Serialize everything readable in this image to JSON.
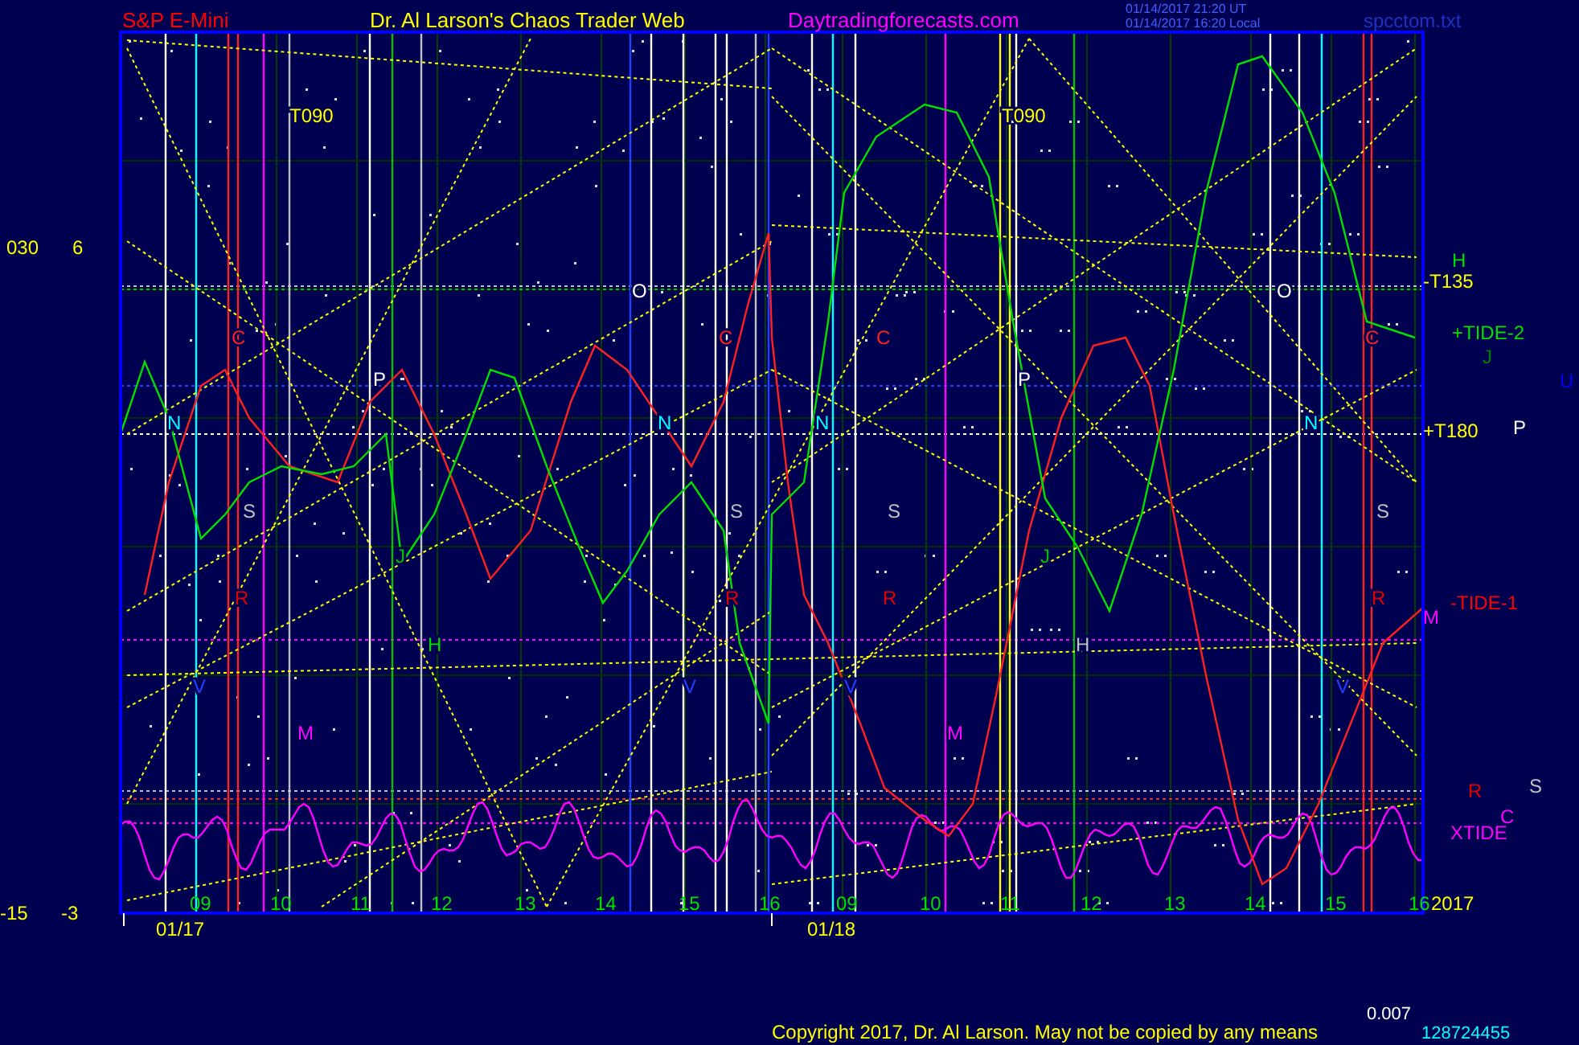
{
  "header": {
    "symbol": "S&P E-Mini",
    "title": "Dr. Al Larson's Chaos Trader Web",
    "site": "Daytradingforecasts.com",
    "time_ut": "01/14/2017 21:20 UT",
    "time_local": "01/14/2017 16:20 Local",
    "file": "spcctom.txt"
  },
  "left_labels": [
    "030",
    "6",
    "-15",
    "-3"
  ],
  "markers": [
    {
      "text": "T090",
      "color": "#ffff00"
    },
    {
      "text": "T090",
      "color": "#ffff00"
    },
    {
      "text": "O",
      "color": "#ffffff"
    },
    {
      "text": "O",
      "color": "#ffffff"
    },
    {
      "text": "C",
      "color": "#ff2020"
    },
    {
      "text": "C",
      "color": "#ff2020"
    },
    {
      "text": "C",
      "color": "#ff2020"
    },
    {
      "text": "C",
      "color": "#ff2020"
    },
    {
      "text": "P",
      "color": "#ffffff"
    },
    {
      "text": "P",
      "color": "#ffffff"
    },
    {
      "text": "N",
      "color": "#00ffff"
    },
    {
      "text": "N",
      "color": "#00ffff"
    },
    {
      "text": "N",
      "color": "#00ffff"
    },
    {
      "text": "N",
      "color": "#00ffff"
    },
    {
      "text": "S",
      "color": "#c0c0c0"
    },
    {
      "text": "S",
      "color": "#c0c0c0"
    },
    {
      "text": "S",
      "color": "#c0c0c0"
    },
    {
      "text": "S",
      "color": "#c0c0c0"
    },
    {
      "text": "J",
      "color": "#00c000"
    },
    {
      "text": "J",
      "color": "#00c000"
    },
    {
      "text": "R",
      "color": "#e00000"
    },
    {
      "text": "R",
      "color": "#e00000"
    },
    {
      "text": "R",
      "color": "#e00000"
    },
    {
      "text": "R",
      "color": "#e00000"
    },
    {
      "text": "H",
      "color": "#00e000"
    },
    {
      "text": "H",
      "color": "#c0c0c0"
    },
    {
      "text": "V",
      "color": "#2040ff"
    },
    {
      "text": "V",
      "color": "#2040ff"
    },
    {
      "text": "V",
      "color": "#2040ff"
    },
    {
      "text": "V",
      "color": "#2040ff"
    },
    {
      "text": "M",
      "color": "#ff00ff"
    },
    {
      "text": "M",
      "color": "#ff00ff"
    }
  ],
  "right_labels": [
    {
      "text": "H",
      "color": "#00e000"
    },
    {
      "text": "-T135",
      "color": "#ffff00"
    },
    {
      "text": "+TIDE-2",
      "color": "#00e000"
    },
    {
      "text": "J",
      "color": "#008000"
    },
    {
      "text": "U",
      "color": "#0000ff"
    },
    {
      "text": "+T180",
      "color": "#ffff00"
    },
    {
      "text": "P",
      "color": "#ffffff"
    },
    {
      "text": "-TIDE-1",
      "color": "#ff0000"
    },
    {
      "text": "M",
      "color": "#ff00ff"
    },
    {
      "text": "R",
      "color": "#e00000"
    },
    {
      "text": "S",
      "color": "#c0c0c0"
    },
    {
      "text": "C",
      "color": "#ff00ff"
    },
    {
      "text": "XTIDE",
      "color": "#ff00ff"
    },
    {
      "text": "2017",
      "color": "#ffff00"
    }
  ],
  "hours": [
    "09",
    "10",
    "11",
    "12",
    "13",
    "14",
    "15",
    "16",
    "09",
    "10",
    "11",
    "12",
    "13",
    "14",
    "15",
    "16"
  ],
  "dates": [
    "01/17",
    "01/18"
  ],
  "footer": {
    "copyright": "Copyright 2017, Dr. Al Larson. May not be copied by any means",
    "value": "0.007",
    "id": "128724455"
  }
}
